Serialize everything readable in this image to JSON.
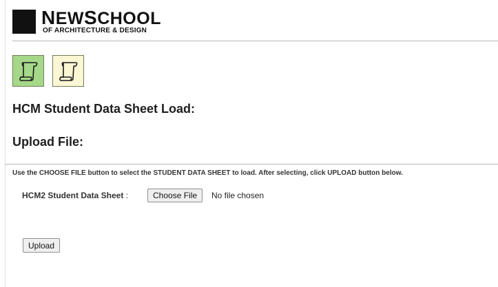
{
  "logo": {
    "main_cap1": "N",
    "main_rest1": "EW",
    "main_cap2": "S",
    "main_rest2": "CHOOL",
    "sub": "OF ARCHITECTURE & DESIGN"
  },
  "toolbar": {
    "icon1": "scroll-icon",
    "icon2": "scroll-icon",
    "active_color": "#a5d889",
    "inactive_color": "#fbf6d3"
  },
  "page": {
    "title": "HCM Student Data Sheet Load:",
    "upload_heading": "Upload File:",
    "instructions": "Use the CHOOSE FILE button to select the STUDENT DATA SHEET to load. After selecting, click UPLOAD button below."
  },
  "form": {
    "field_label": "HCM2 Student Data Sheet",
    "field_colon": ":",
    "choose_label": "Choose File",
    "no_file_text": "No file chosen",
    "upload_label": "Upload"
  }
}
